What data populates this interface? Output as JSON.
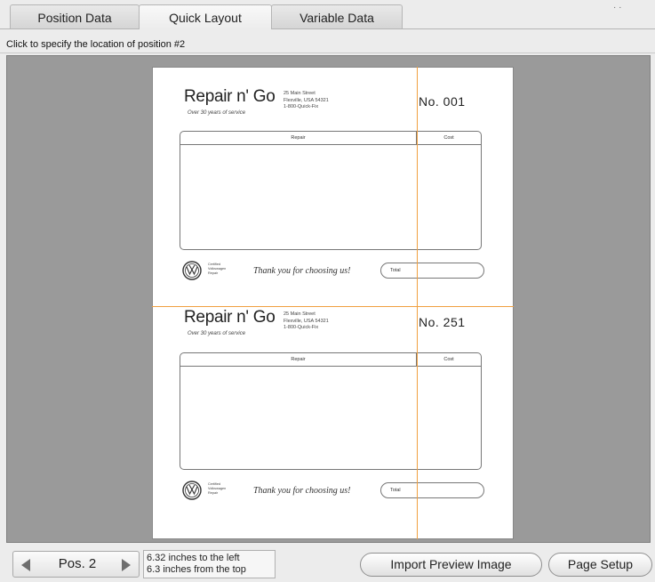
{
  "tabs": [
    {
      "label": "Position Data",
      "active": false
    },
    {
      "label": "Quick Layout",
      "active": true
    },
    {
      "label": "Variable Data",
      "active": false
    }
  ],
  "instruction": "Click to specify the location of position #2",
  "receipts": [
    {
      "title": "Repair n' Go",
      "tagline": "Over 30 years of service",
      "address": "25 Main Street\nFlexville, USA 54321\n1-800-Quick-Fix",
      "number": "No. 001",
      "col_repair": "Repair",
      "col_cost": "Cost",
      "certified": "Certified\nVolkswagen\nRepair",
      "thanks": "Thank you for choosing us!",
      "total": "Total"
    },
    {
      "title": "Repair n' Go",
      "tagline": "Over 30 years of service",
      "address": "25 Main Street\nFlexville, USA 54321\n1-800-Quick-Fix",
      "number": "No. 251",
      "col_repair": "Repair",
      "col_cost": "Cost",
      "certified": "Certified\nVolkswagen\nRepair",
      "thanks": "Thank you for choosing us!",
      "total": "Total"
    }
  ],
  "position": {
    "label": "Pos. 2",
    "left_text": "6.32 inches to the left",
    "top_text": "6.3 inches from the top"
  },
  "buttons": {
    "import": "Import Preview Image",
    "page_setup": "Page Setup"
  },
  "colors": {
    "guide": "#f0a040",
    "canvas": "#9a9a9a"
  },
  "icons": {
    "prev": "triangle-left-icon",
    "next": "triangle-right-icon",
    "logo": "vw-logo-icon"
  }
}
